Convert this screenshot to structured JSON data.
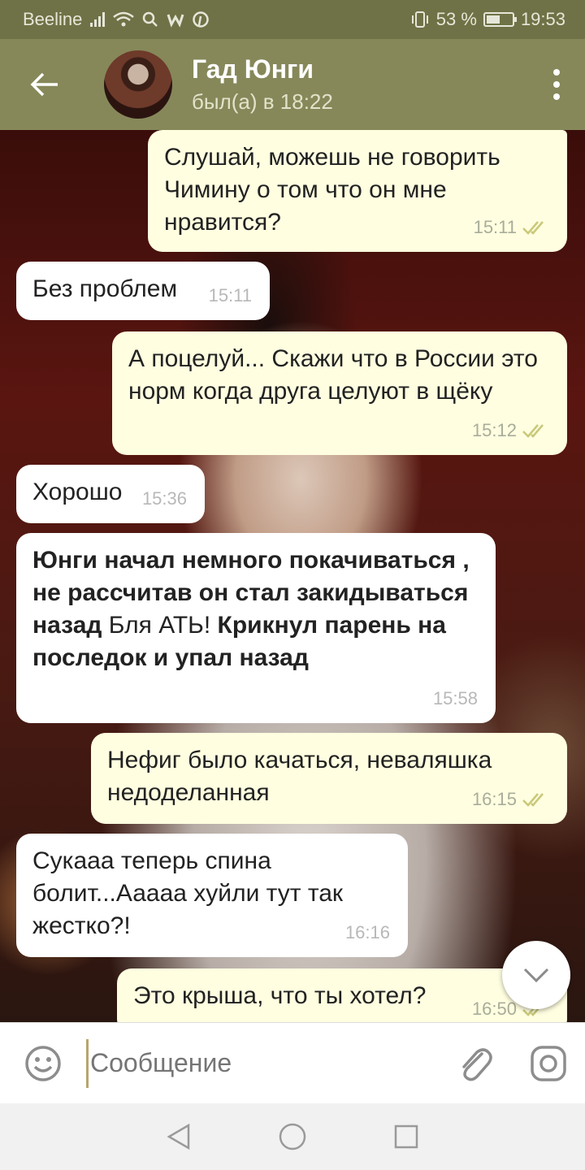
{
  "status_bar": {
    "carrier": "Beeline",
    "battery": "53 %",
    "battery_level": 0.53,
    "time": "19:53"
  },
  "header": {
    "name": "Гад Юнги",
    "last_seen": "был(а) в 18:22"
  },
  "messages": [
    {
      "dir": "out",
      "text": "Слушай, можешь не говорить Чимину о том что он мне нравится?",
      "time": "15:11",
      "read": true
    },
    {
      "dir": "in",
      "text": "Без проблем",
      "time": "15:11"
    },
    {
      "dir": "out",
      "text": "А поцелуй... Скажи что в России это норм когда друга целуют в щёку",
      "time": "15:12",
      "read": true
    },
    {
      "dir": "in",
      "text": "Хорошо",
      "time": "15:36"
    },
    {
      "dir": "in",
      "bold_1": "Юнги начал немного покачиваться , не рассчитав он стал закидываться назад",
      "plain": " Бля АТЬ! ",
      "bold_2": "Крикнул парень на последок и упал назад",
      "time": "15:58"
    },
    {
      "dir": "out",
      "text": "Нефиг было качаться, неваляшка недоделанная",
      "time": "16:15",
      "read": true
    },
    {
      "dir": "in",
      "text": "Сукааа теперь спина болит...Ааааа хуйли тут так жестко?!",
      "time": "16:16"
    },
    {
      "dir": "out",
      "text": "Это крыша, что ты хотел?",
      "time": "16:50",
      "read": true
    }
  ],
  "input": {
    "placeholder": "Сообщение"
  },
  "colors": {
    "header": "#86885a",
    "status_bar": "#6f7246",
    "outgoing_bubble": "#fffee0",
    "incoming_bubble": "#ffffff",
    "tick": "#c9c97a"
  },
  "icons": {
    "back": "arrow-left-icon",
    "menu": "more-vert-icon",
    "emoji": "smile-icon",
    "attach": "paperclip-icon",
    "camera": "camera-icon",
    "scroll": "chevron-down-icon",
    "nav_back": "triangle-left-icon",
    "nav_home": "circle-icon",
    "nav_recent": "square-icon"
  }
}
